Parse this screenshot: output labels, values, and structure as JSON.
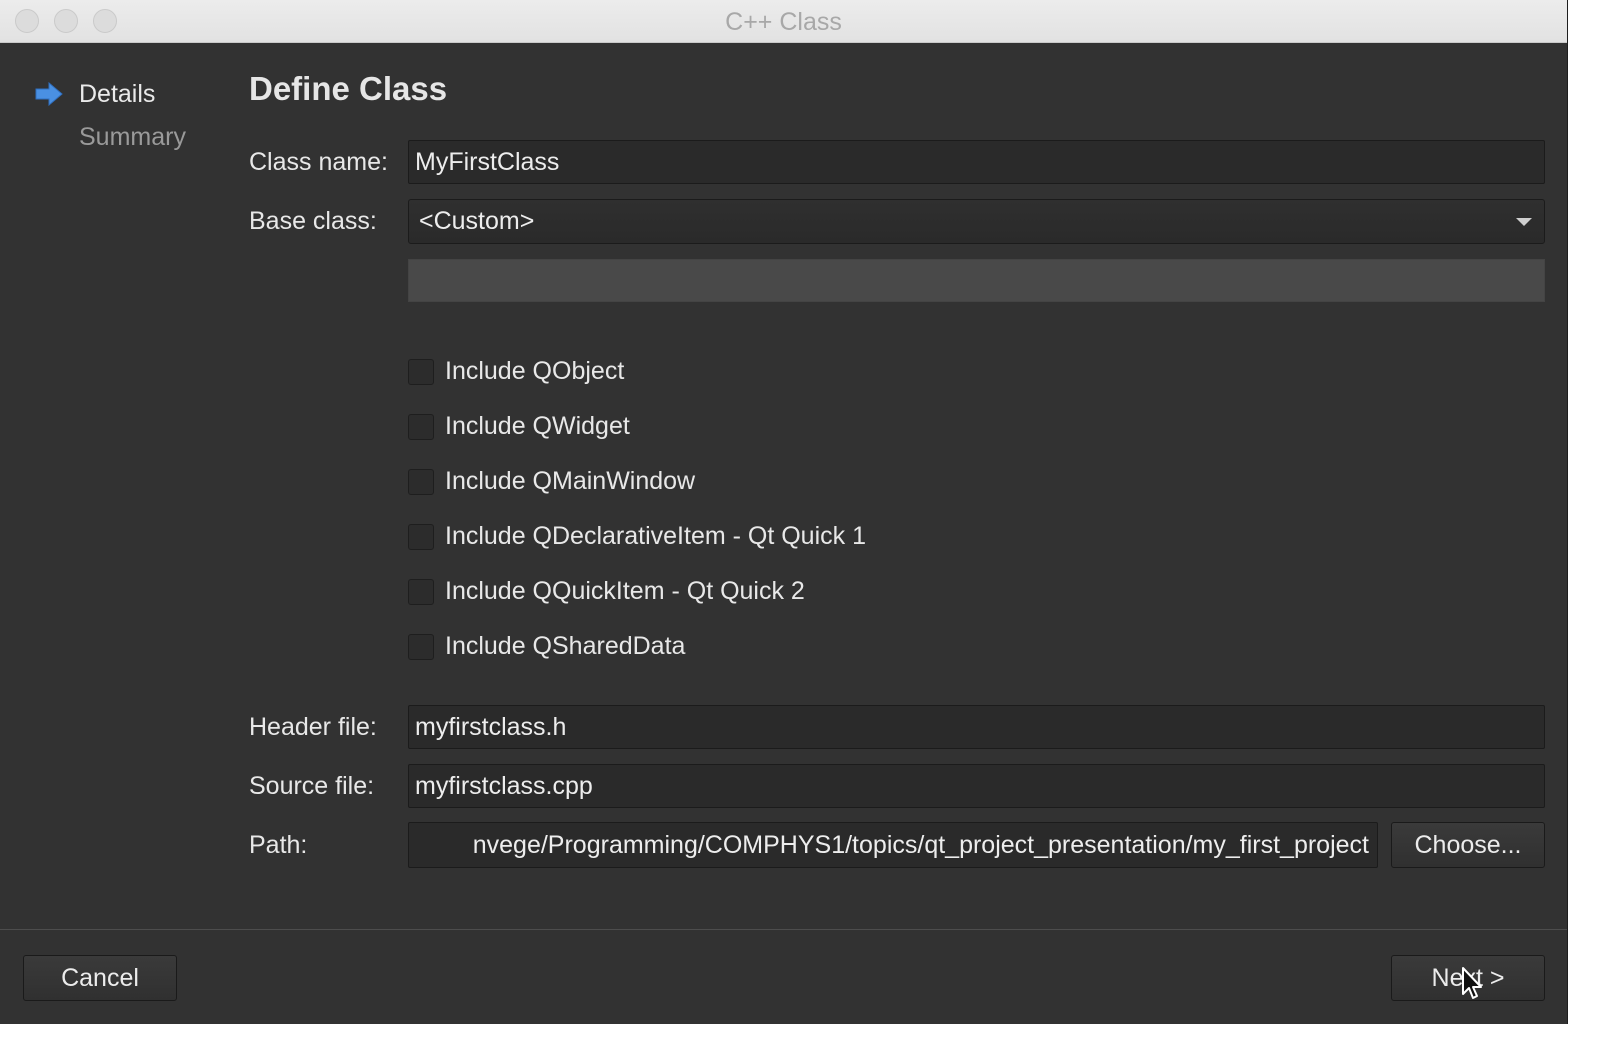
{
  "window": {
    "title": "C++ Class"
  },
  "sidebar": {
    "items": [
      {
        "label": "Details",
        "active": true,
        "icon": "arrow-right-icon"
      },
      {
        "label": "Summary",
        "active": false
      }
    ]
  },
  "page": {
    "heading": "Define Class"
  },
  "form": {
    "class_name_label": "Class name:",
    "class_name_value": "MyFirstClass",
    "base_class_label": "Base class:",
    "base_class_value": "<Custom>",
    "custom_base_value": "",
    "checkboxes": [
      {
        "label": "Include QObject",
        "checked": false
      },
      {
        "label": "Include QWidget",
        "checked": false
      },
      {
        "label": "Include QMainWindow",
        "checked": false
      },
      {
        "label": "Include QDeclarativeItem - Qt Quick 1",
        "checked": false
      },
      {
        "label": "Include QQuickItem - Qt Quick 2",
        "checked": false
      },
      {
        "label": "Include QSharedData",
        "checked": false
      }
    ],
    "header_file_label": "Header file:",
    "header_file_value": "myfirstclass.h",
    "source_file_label": "Source file:",
    "source_file_value": "myfirstclass.cpp",
    "path_label": "Path:",
    "path_value": "nvege/Programming/COMPHYS1/topics/qt_project_presentation/my_first_project",
    "choose_label": "Choose..."
  },
  "footer": {
    "cancel_label": "Cancel",
    "next_label": "Next >"
  },
  "colors": {
    "window_bg": "#323232",
    "accent_arrow": "#4a90e2",
    "text": "#e8e8e8",
    "muted_text": "#9a9a9a"
  }
}
